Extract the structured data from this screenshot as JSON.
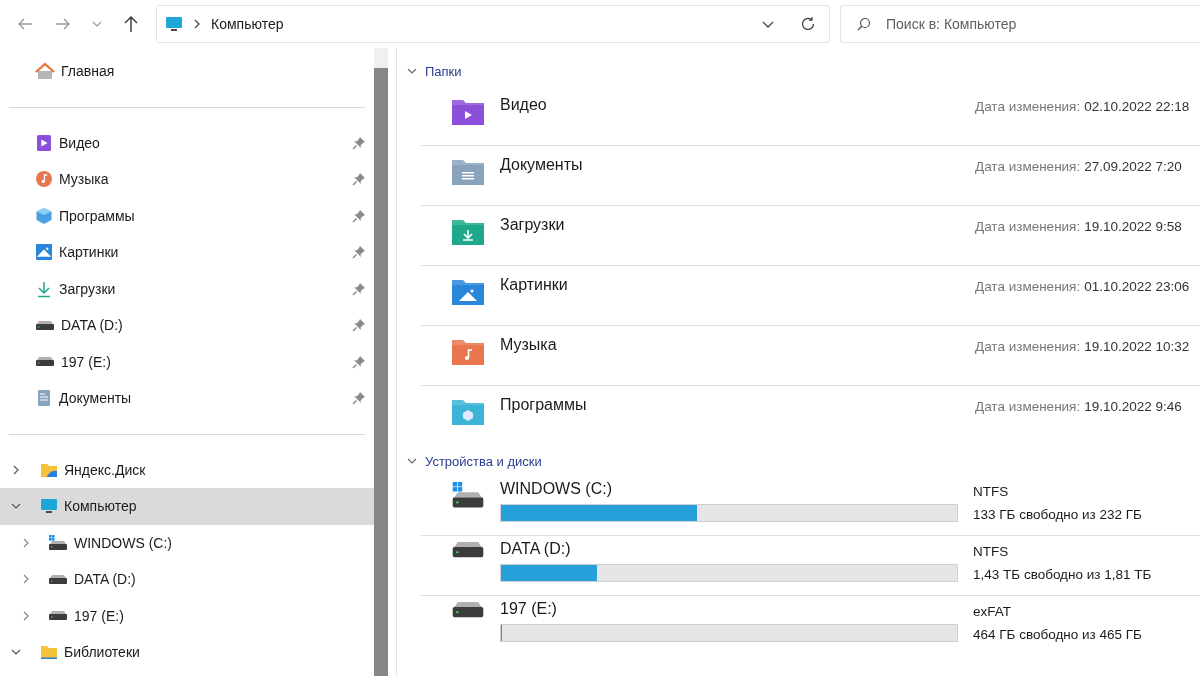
{
  "address": {
    "path": "Компьютер"
  },
  "search": {
    "placeholder": "Поиск в: Компьютер"
  },
  "sidebar": {
    "home": {
      "label": "Главная"
    },
    "pinned": [
      {
        "label": "Видео",
        "kind": "video",
        "pinned": true
      },
      {
        "label": "Музыка",
        "kind": "music",
        "pinned": true
      },
      {
        "label": "Программы",
        "kind": "programs",
        "pinned": true
      },
      {
        "label": "Картинки",
        "kind": "pictures",
        "pinned": true
      },
      {
        "label": "Загрузки",
        "kind": "downloads",
        "pinned": true
      },
      {
        "label": "DATA (D:)",
        "kind": "drive",
        "pinned": true
      },
      {
        "label": "197 (E:)",
        "kind": "drive",
        "pinned": true
      },
      {
        "label": "Документы",
        "kind": "documents",
        "pinned": true
      }
    ],
    "tree": [
      {
        "label": "Яндекс.Диск",
        "kind": "cloud",
        "expanded": false,
        "selected": false
      },
      {
        "label": "Компьютер",
        "kind": "pc",
        "expanded": true,
        "selected": true,
        "children": [
          {
            "label": "WINDOWS (C:)",
            "kind": "sysdrive",
            "expanded": false,
            "selected": false
          },
          {
            "label": "DATA (D:)",
            "kind": "drive",
            "expanded": false,
            "selected": false
          },
          {
            "label": "197 (E:)",
            "kind": "drive",
            "expanded": false,
            "selected": false
          }
        ]
      },
      {
        "label": "Библиотеки",
        "kind": "library",
        "expanded": true,
        "selected": false
      }
    ]
  },
  "sections": [
    {
      "title": "Папки",
      "kind": "folders",
      "expanded": true,
      "items": [
        {
          "name": "Видео",
          "kind": "video",
          "date_label": "Дата изменения:",
          "date": "02.10.2022 22:18"
        },
        {
          "name": "Документы",
          "kind": "documents",
          "date_label": "Дата изменения:",
          "date": "27.09.2022 7:20"
        },
        {
          "name": "Загрузки",
          "kind": "downloads",
          "date_label": "Дата изменения:",
          "date": "19.10.2022 9:58"
        },
        {
          "name": "Картинки",
          "kind": "pictures",
          "date_label": "Дата изменения:",
          "date": "01.10.2022 23:06"
        },
        {
          "name": "Музыка",
          "kind": "music",
          "date_label": "Дата изменения:",
          "date": "19.10.2022 10:32"
        },
        {
          "name": "Программы",
          "kind": "programs",
          "date_label": "Дата изменения:",
          "date": "19.10.2022 9:46"
        }
      ]
    },
    {
      "title": "Устройства и диски",
      "kind": "drives",
      "expanded": true,
      "items": [
        {
          "name": "WINDOWS (C:)",
          "kind": "sysdrive",
          "fs": "NTFS",
          "space": "133 ГБ свободно из 232 ГБ",
          "level": 0.43
        },
        {
          "name": "DATA (D:)",
          "kind": "drive",
          "fs": "NTFS",
          "space": "1,43 ТБ свободно из 1,81 ТБ",
          "level": 0.21
        },
        {
          "name": "197 (E:)",
          "kind": "drive",
          "fs": "exFAT",
          "space": "464 ГБ свободно из 465 ГБ",
          "level": 0.002
        }
      ]
    }
  ]
}
